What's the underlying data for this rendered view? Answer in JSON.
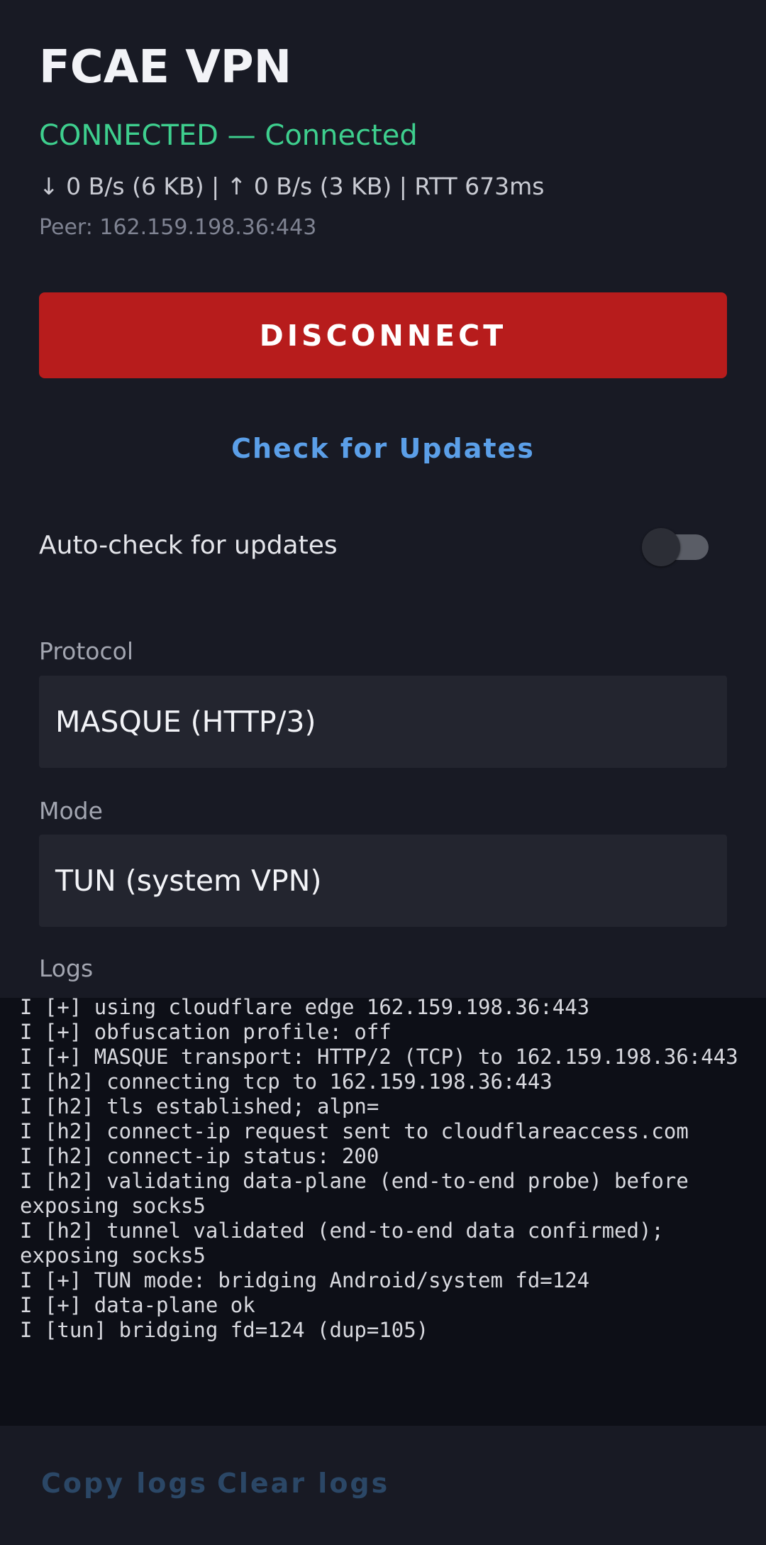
{
  "app": {
    "title": "FCAE VPN",
    "status": "CONNECTED — Connected",
    "stats": "↓ 0 B/s (6 KB)  |  ↑ 0 B/s (3 KB)  |  RTT 673ms",
    "peer": "Peer: 162.159.198.36:443"
  },
  "actions": {
    "disconnect_label": "DISCONNECT",
    "check_updates_label": "Check for Updates"
  },
  "settings": {
    "auto_check_label": "Auto-check for updates",
    "auto_check_enabled": false,
    "protocol_label": "Protocol",
    "protocol_value": "MASQUE (HTTP/3)",
    "mode_label": "Mode",
    "mode_value": "TUN (system VPN)"
  },
  "logs": {
    "label": "Logs",
    "lines": [
      "I [+] using cloudflare edge 162.159.198.36:443",
      "I [+] obfuscation profile: off",
      "I [+] MASQUE transport: HTTP/2 (TCP) to 162.159.198.36:443",
      "I [h2] connecting tcp to 162.159.198.36:443",
      "I [h2] tls established; alpn=",
      "I [h2] connect-ip request sent to cloudflareaccess.com",
      "I [h2] connect-ip status: 200",
      "I [h2] validating data-plane (end-to-end probe) before exposing socks5",
      "I [h2] tunnel validated (end-to-end data confirmed); exposing socks5",
      "I [+] TUN mode: bridging Android/system fd=124",
      "I [+] data-plane ok",
      "I [tun] bridging fd=124 (dup=105)"
    ],
    "copy_label": "Copy logs",
    "clear_label": "Clear logs"
  },
  "colors": {
    "background": "#181a24",
    "connected": "#3ecf8e",
    "disconnect": "#b71c1c",
    "link": "#5b9fe8"
  }
}
